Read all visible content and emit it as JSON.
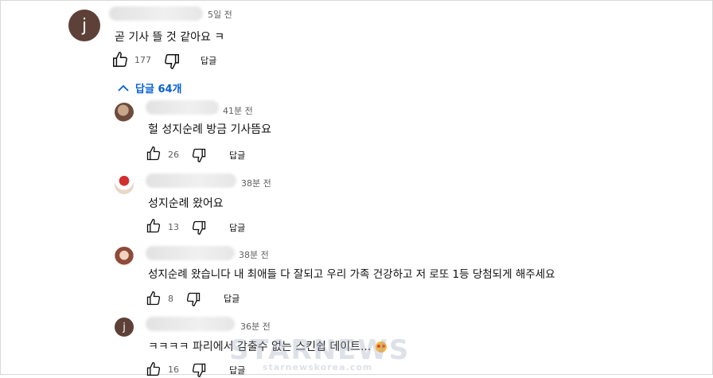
{
  "comment": {
    "avatar_letter": "j",
    "time": "5일 전",
    "text": "곧 기사 뜰 것 같아요 ㅋ",
    "likes": "177",
    "reply_label": "답글"
  },
  "replies_toggle": {
    "label": "답글 64개"
  },
  "replies": [
    {
      "time": "41분 전",
      "text": "헐 성지순례 방금 기사뜸요",
      "likes": "26",
      "reply_label": "답글"
    },
    {
      "time": "38분 전",
      "text": "성지순례 왔어요",
      "likes": "13",
      "reply_label": "답글"
    },
    {
      "time": "38분 전",
      "text": "성지순례 왔습니다 내 최애들 다 잘되고 우리 가족 건강하고 저 로또 1등 당첨되게 해주세요",
      "likes": "8",
      "reply_label": "답글"
    },
    {
      "avatar_letter": "j",
      "time": "36분 전",
      "text": "ㅋㅋㅋㅋ 파리에서 감출수 없는 스킨쉽 데이트...",
      "likes": "16",
      "reply_label": "답글"
    }
  ],
  "watermark": {
    "brand": "STARNEWS",
    "url": "starnewskorea.com"
  },
  "colors": {
    "link": "#065fd4",
    "avatar_j": "#5d4037"
  }
}
